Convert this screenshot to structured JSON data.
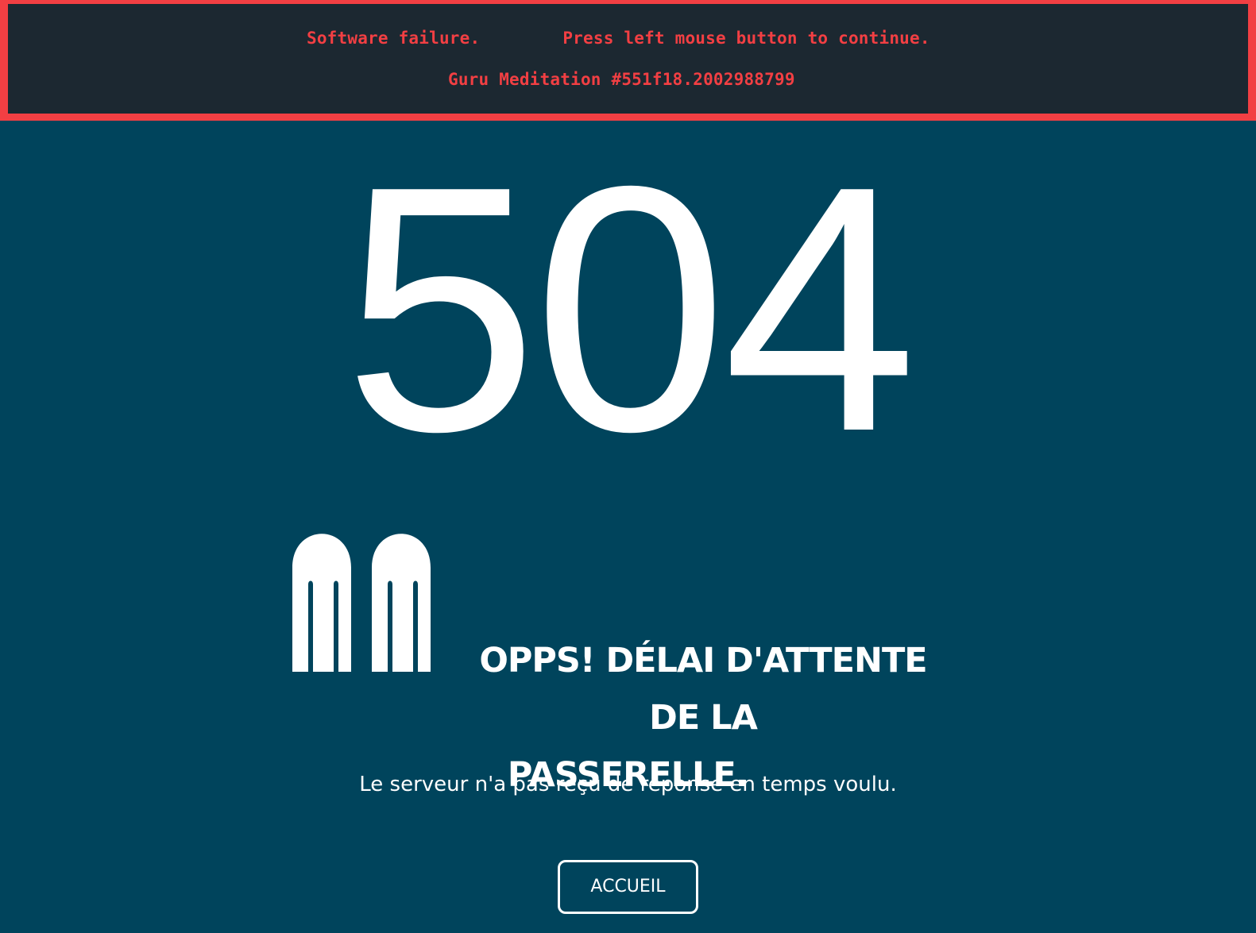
{
  "guru": {
    "line1_left": "Software failure.",
    "line1_right": "Press left mouse button to continue.",
    "line2": "Guru Meditation #551f18.2002988799",
    "border_color": "#f23f43",
    "background_color": "#1c2831"
  },
  "error": {
    "code": "504",
    "headline_line1": "OPPS! DÉLAI D'ATTENTE DE LA",
    "headline_line2": "PASSERELLE.",
    "description": "Le serveur n'a pas reçu de réponse en temps voulu."
  },
  "mascot": {
    "icon": "ghost-comb-icon"
  },
  "actions": {
    "home_label": "ACCUEIL"
  },
  "colors": {
    "page_background": "#00445c",
    "text": "#ffffff"
  }
}
